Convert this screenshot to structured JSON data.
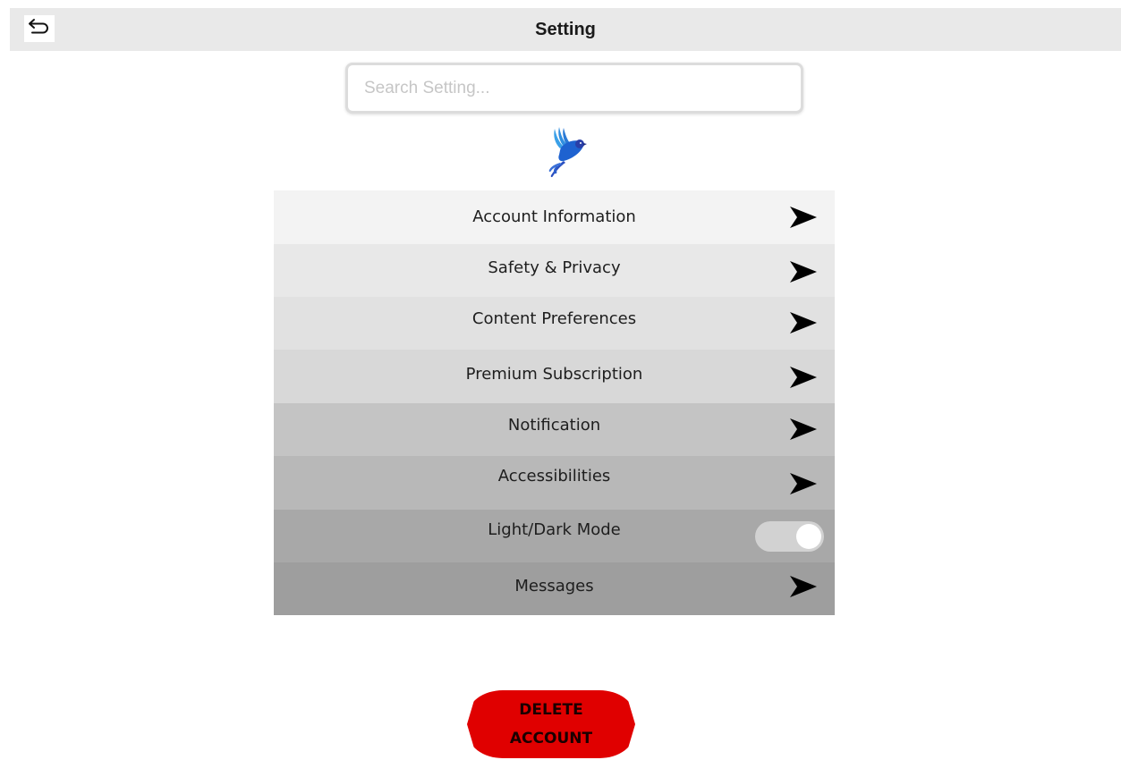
{
  "header": {
    "title": "Setting",
    "back_icon": "undo-arrow-icon"
  },
  "search": {
    "placeholder": "Search Setting...",
    "value": ""
  },
  "logo": {
    "icon": "blue-bird-logo",
    "colors": [
      "#1e62d0",
      "#3aa0e8",
      "#2a3fa8"
    ]
  },
  "menu": {
    "items": [
      {
        "label": "Account Information",
        "control": "arrow",
        "background": "#f3f3f3"
      },
      {
        "label": "Safety & Privacy",
        "control": "arrow",
        "background": "#e8e8e8"
      },
      {
        "label": "Content Preferences",
        "control": "arrow",
        "background": "#e1e1e1"
      },
      {
        "label": "Premium Subscription",
        "control": "arrow",
        "background": "#d8d8d8"
      },
      {
        "label": "Notification",
        "control": "arrow",
        "background": "#c4c4c4"
      },
      {
        "label": "Accessibilities",
        "control": "arrow",
        "background": "#b8b8b8"
      },
      {
        "label": "Light/Dark Mode",
        "control": "toggle",
        "toggle_on": true,
        "background": "#a8a8a8"
      },
      {
        "label": "Messages",
        "control": "arrow",
        "background": "#9e9e9e"
      }
    ]
  },
  "delete_button": {
    "line1": "DELETE",
    "line2": "ACCOUNT",
    "color": "#e00000"
  }
}
